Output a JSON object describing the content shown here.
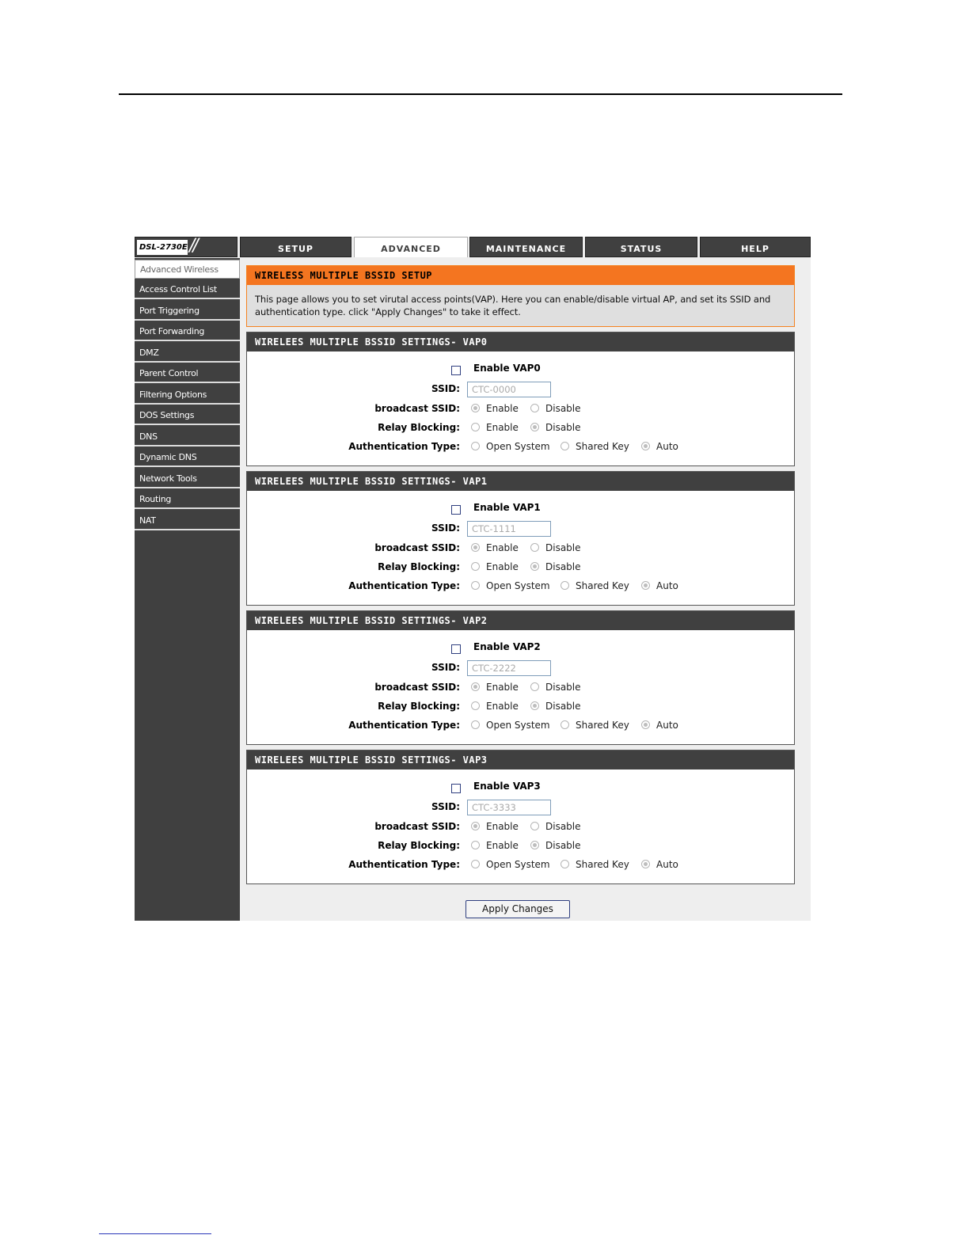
{
  "logo": {
    "model": "DSL-2730E"
  },
  "tabs": [
    {
      "label": "SETUP",
      "active": false
    },
    {
      "label": "ADVANCED",
      "active": true
    },
    {
      "label": "MAINTENANCE",
      "active": false
    },
    {
      "label": "STATUS",
      "active": false
    },
    {
      "label": "HELP",
      "active": false
    }
  ],
  "sidebar": {
    "items": [
      {
        "label": "Advanced Wireless",
        "active": true
      },
      {
        "label": "Access Control List"
      },
      {
        "label": "Port Triggering"
      },
      {
        "label": "Port Forwarding"
      },
      {
        "label": "DMZ"
      },
      {
        "label": "Parent Control"
      },
      {
        "label": "Filtering Options"
      },
      {
        "label": "DOS Settings"
      },
      {
        "label": "DNS"
      },
      {
        "label": "Dynamic DNS"
      },
      {
        "label": "Network Tools"
      },
      {
        "label": "Routing"
      },
      {
        "label": "NAT"
      }
    ]
  },
  "intro": {
    "title": "WIRELESS MULTIPLE BSSID SETUP",
    "text": "This page allows you to set virutal access points(VAP). Here you can enable/disable virtual AP, and set its SSID and authentication type. click \"Apply Changes\" to take it effect."
  },
  "labels": {
    "ssid": "SSID:",
    "broadcast": "broadcast SSID:",
    "relay": "Relay Blocking:",
    "auth": "Authentication Type:",
    "enable": "Enable",
    "disable": "Disable",
    "open": "Open System",
    "shared": "Shared Key",
    "auto": "Auto"
  },
  "vaps": [
    {
      "title": "WIRELEES MULTIPLE BSSID SETTINGS- VAP0",
      "enable_label": "Enable VAP0",
      "enabled": false,
      "ssid": "CTC-0000",
      "broadcast": "Enable",
      "relay": "Disable",
      "auth": "Auto"
    },
    {
      "title": "WIRELEES MULTIPLE BSSID SETTINGS- VAP1",
      "enable_label": "Enable VAP1",
      "enabled": false,
      "ssid": "CTC-1111",
      "broadcast": "Enable",
      "relay": "Disable",
      "auth": "Auto"
    },
    {
      "title": "WIRELEES MULTIPLE BSSID SETTINGS- VAP2",
      "enable_label": "Enable VAP2",
      "enabled": false,
      "ssid": "CTC-2222",
      "broadcast": "Enable",
      "relay": "Disable",
      "auth": "Auto"
    },
    {
      "title": "WIRELEES MULTIPLE BSSID SETTINGS- VAP3",
      "enable_label": "Enable VAP3",
      "enabled": false,
      "ssid": "CTC-3333",
      "broadcast": "Enable",
      "relay": "Disable",
      "auth": "Auto"
    }
  ],
  "apply_label": "Apply Changes"
}
